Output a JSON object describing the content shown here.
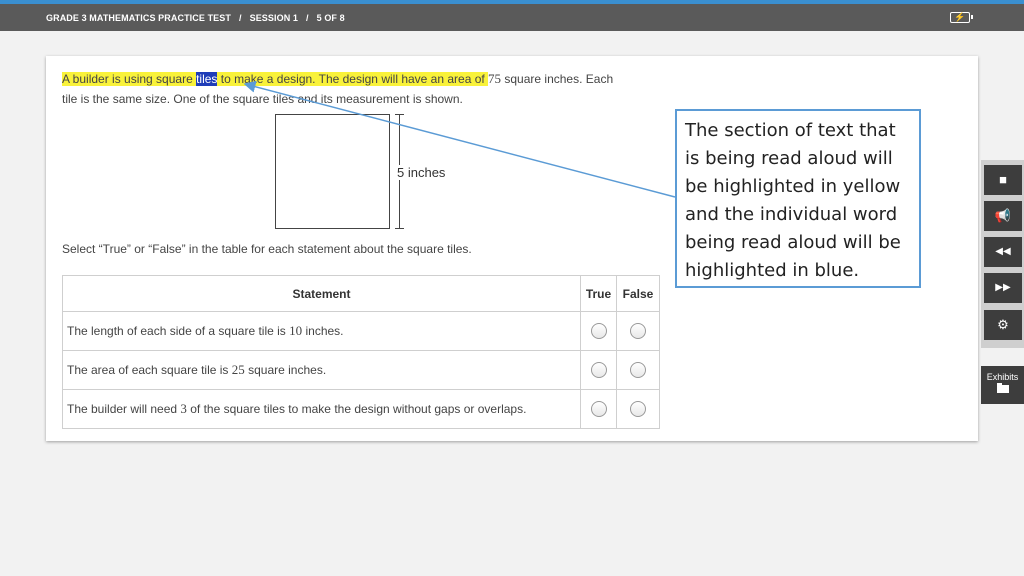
{
  "header": {
    "test_title": "GRADE 3 MATHEMATICS PRACTICE TEST",
    "separator": "/",
    "session": "SESSION 1",
    "page": "5 OF 8",
    "battery_icon": "battery-charging-icon"
  },
  "question": {
    "hl_before": "A builder is using square ",
    "hl_word": "tiles",
    "hl_after": " to make a design. The design will have an area of ",
    "area_value": "75",
    "rest_line1": " square inches. Each",
    "rest_line2": "tile is the same size. One of the square tiles and its measurement is shown.",
    "dimension_label": "5 inches",
    "instruction": "Select “True” or “False” in the table for each statement about the square tiles."
  },
  "table": {
    "headers": [
      "Statement",
      "True",
      "False"
    ],
    "rows": [
      {
        "before": "The length of each side of a square tile is ",
        "value": "10",
        "after": " inches."
      },
      {
        "before": "The area of each square tile is ",
        "value": "25",
        "after": " square inches."
      },
      {
        "before": "The builder will need ",
        "value": "3",
        "after": " of the square tiles to make the design without gaps or overlaps."
      }
    ]
  },
  "callout": {
    "text": "The section of text that is being read aloud will be highlighted in yellow and the individual word being read aloud will be highlighted in blue."
  },
  "sidebar": {
    "buttons": [
      {
        "icon": "stop-icon",
        "glyph": "■"
      },
      {
        "icon": "speaker-icon",
        "glyph": "📢"
      },
      {
        "icon": "rewind-icon",
        "glyph": "◀◀"
      },
      {
        "icon": "fast-forward-icon",
        "glyph": "▶▶"
      },
      {
        "icon": "settings-gear-icon",
        "glyph": "⚙"
      }
    ],
    "exhibits_label": "Exhibits",
    "exhibits_icon": "folder-icon"
  },
  "colors": {
    "highlight_yellow": "#f9f23a",
    "highlight_blue": "#1f3db8",
    "callout_border": "#5b9bd5",
    "topbar": "#5a5a5a"
  }
}
